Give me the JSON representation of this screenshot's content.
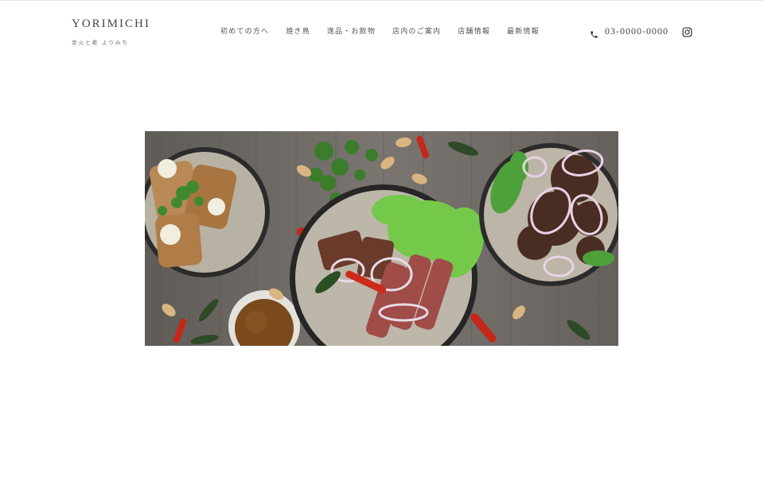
{
  "brand": {
    "title": "YORIMICHI",
    "subtitle": "炭火と肴 よりみち"
  },
  "nav": {
    "items": [
      {
        "label": "初めての方へ"
      },
      {
        "label": "焼き鳥"
      },
      {
        "label": "逸品・お飲物"
      },
      {
        "label": "店内のご案内"
      },
      {
        "label": "店舗情報"
      },
      {
        "label": "最新情報"
      }
    ]
  },
  "contact": {
    "phone": "03-0000-0000",
    "phone_icon": "phone-icon",
    "social_icon": "instagram-icon"
  },
  "hero": {
    "image": "food-dishes-photo"
  },
  "colors": {
    "text": "#444444",
    "background": "#ffffff"
  }
}
